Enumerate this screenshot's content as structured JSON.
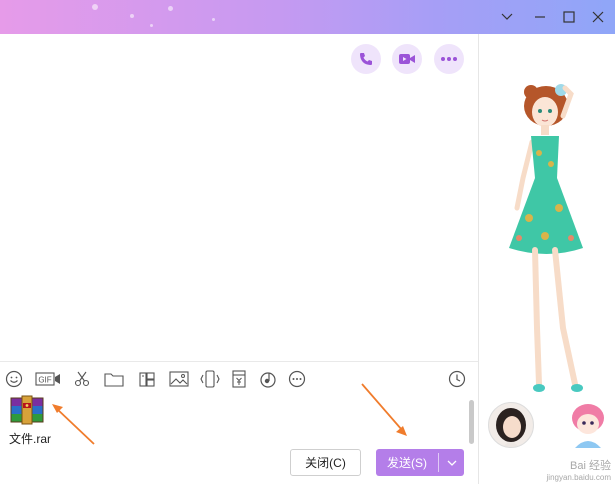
{
  "window": {
    "controls": {
      "chevron_icon": "chevron-down-icon",
      "minimize_icon": "minimize-icon",
      "maximize_icon": "maximize-icon",
      "close_icon": "close-icon"
    }
  },
  "chat_actions": [
    {
      "name": "voice-call-button",
      "icon": "phone-icon"
    },
    {
      "name": "video-call-button",
      "icon": "video-camera-icon"
    },
    {
      "name": "more-button",
      "icon": "more-dots-icon"
    }
  ],
  "toolbar": {
    "emoji_icon": "smile-icon",
    "gif_label": "GIF",
    "icons": [
      "scissors-icon",
      "folder-icon",
      "image-search-icon",
      "picture-icon",
      "phone-shake-icon",
      "red-packet-icon",
      "music-icon",
      "more-circle-icon"
    ],
    "history_icon": "clock-icon"
  },
  "attachment": {
    "icon": "winrar-archive-icon",
    "filename": "文件.rar"
  },
  "buttons": {
    "close_label": "关闭(C)",
    "send_label": "发送(S)"
  },
  "colors": {
    "accent": "#b47ee9",
    "annotation_arrow": "#f07c2c"
  },
  "watermark": {
    "line1": "Bai 经验",
    "line2": "jingyan.baidu.com"
  }
}
